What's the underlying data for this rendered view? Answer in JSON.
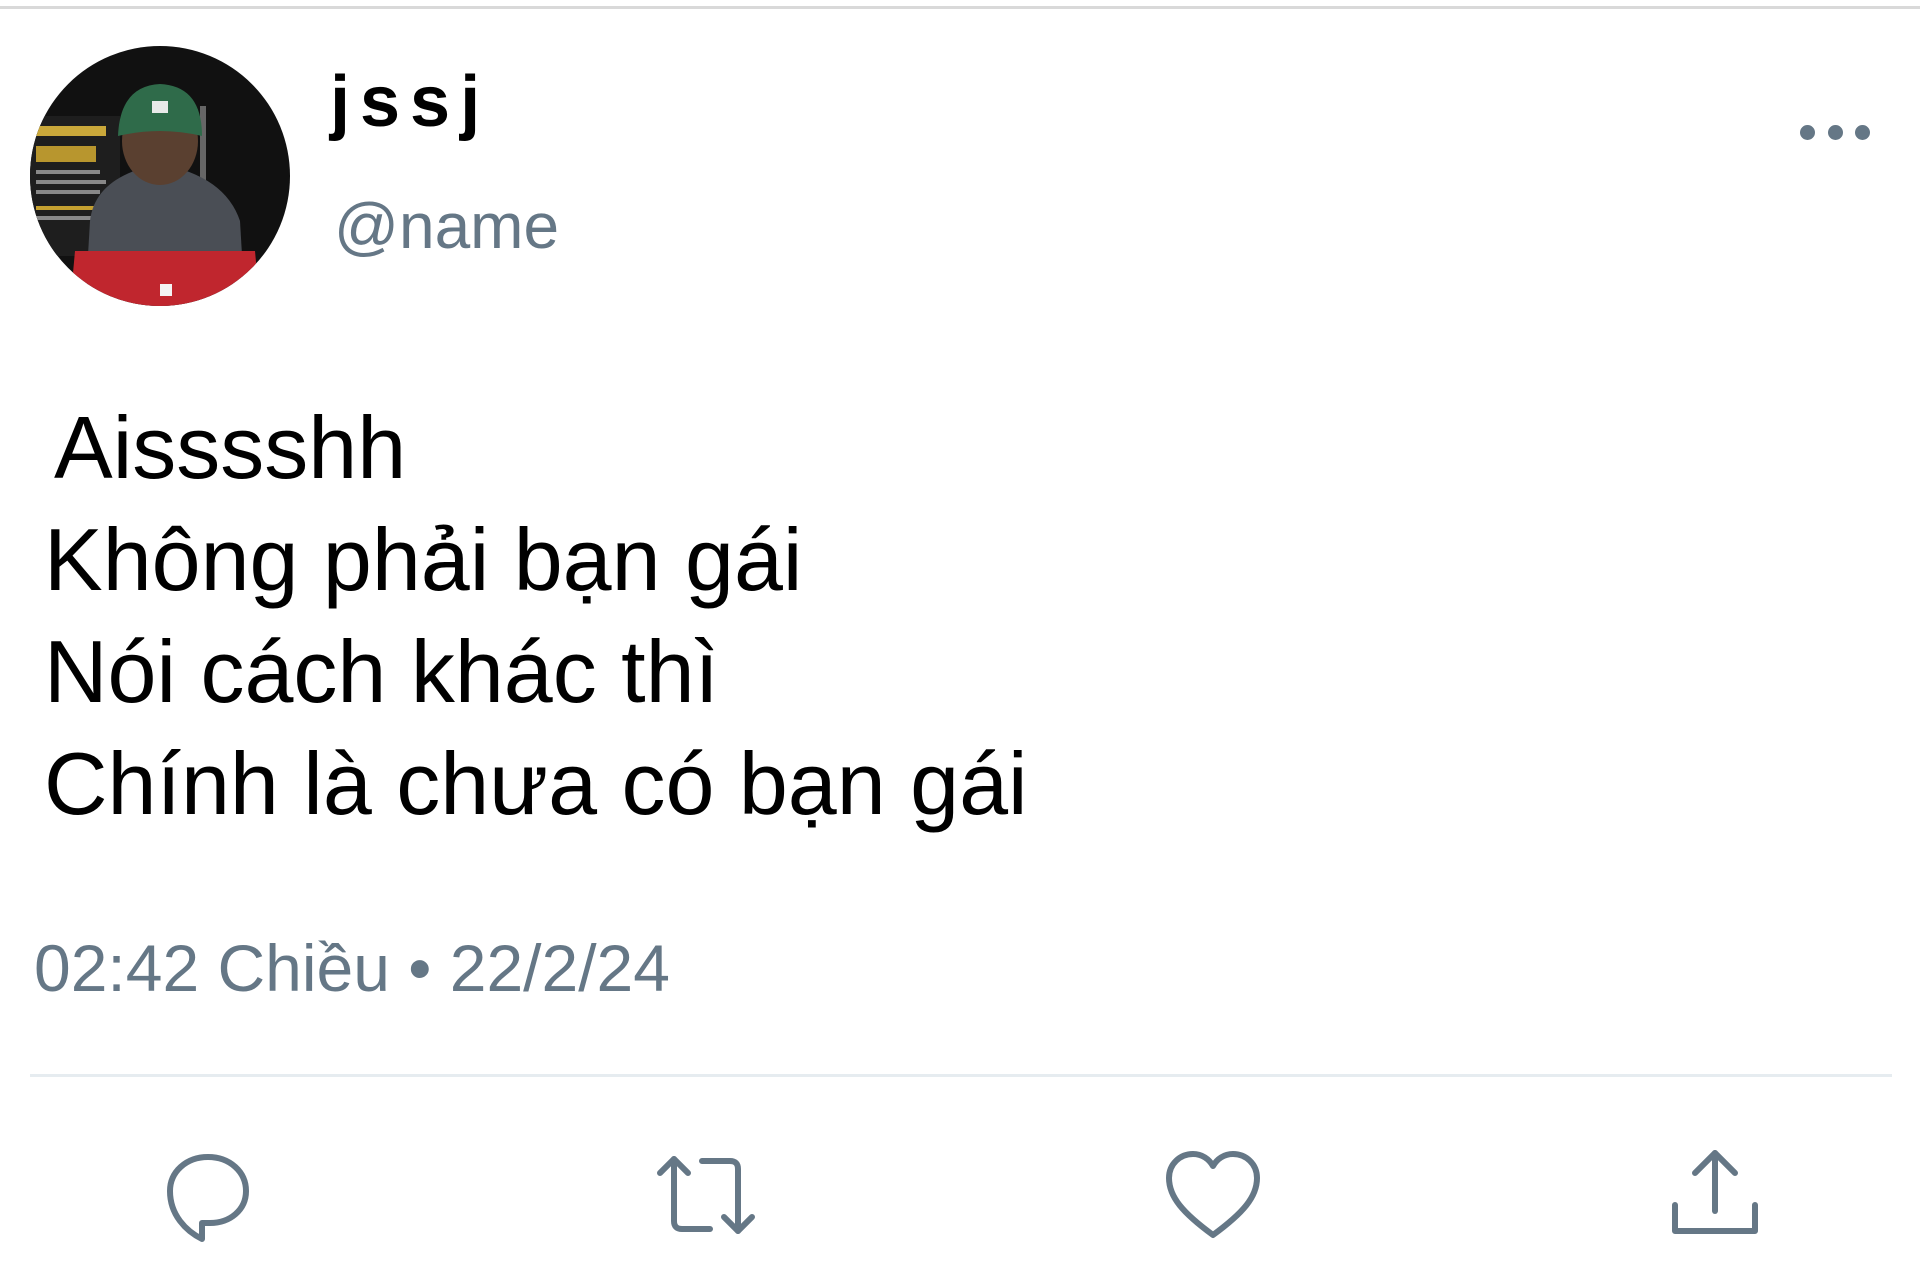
{
  "tweet": {
    "display_name": "jssj",
    "handle": "@name",
    "text_lines": [
      "Aisssshh",
      "Không phải bạn gái",
      "Nói cách khác thì",
      "Chính là chưa có bạn gái"
    ],
    "time": "02:42 Chiều",
    "separator": "•",
    "date": "22/2/24"
  },
  "icons": {
    "more": "more-horizontal-icon",
    "reply": "reply-icon",
    "retweet": "retweet-icon",
    "like": "heart-icon",
    "share": "share-icon"
  },
  "colors": {
    "secondary_text": "#657786",
    "divider": "#e6ecf0",
    "icon": "#657786"
  }
}
